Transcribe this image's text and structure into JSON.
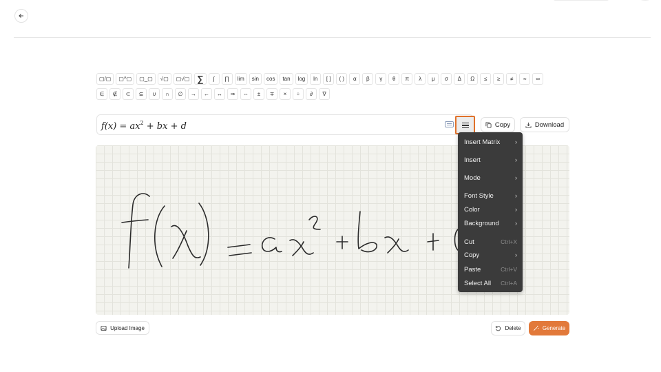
{
  "symbols_row1": [
    "▢/▢",
    "▢^▢",
    "▢_▢",
    "√▢",
    "▢√▢",
    "∑",
    "∫",
    "∏",
    "lim",
    "sin",
    "cos",
    "tan",
    "log",
    "ln",
    "[ ]",
    "( )",
    "α",
    "β",
    "γ",
    "θ",
    "π",
    "λ",
    "μ",
    "σ",
    "Δ",
    "Ω",
    "≤",
    "≥",
    "≠",
    "≈",
    "∞"
  ],
  "symbols_row2": [
    "∈",
    "∉",
    "⊂",
    "⊆",
    "∪",
    "∩",
    "∅",
    "→",
    "←",
    "↔",
    "⇒",
    "⇔",
    "±",
    "∓",
    "×",
    "÷",
    "∂",
    "∇"
  ],
  "expression": {
    "base": "f(x) = ax",
    "exponent": "2",
    "rest": " + bx + d"
  },
  "toolbar": {
    "copy_label": "Copy",
    "download_label": "Download"
  },
  "context_menu": {
    "items": [
      {
        "label": "Insert Matrix",
        "submenu": true
      },
      {
        "label": "Insert",
        "submenu": true
      },
      {
        "label": "Mode",
        "submenu": true
      },
      {
        "label": "Font Style",
        "submenu": true
      },
      {
        "label": "Color",
        "submenu": true
      },
      {
        "label": "Background",
        "submenu": true
      },
      {
        "label": "Cut",
        "shortcut": "Ctrl+X"
      },
      {
        "label": "Copy",
        "submenu": true
      },
      {
        "label": "Paste",
        "shortcut": "Ctrl+V"
      },
      {
        "label": "Select All",
        "shortcut": "Ctrl+A"
      }
    ]
  },
  "bottom": {
    "upload_label": "Upload Image",
    "delete_label": "Delete",
    "generate_label": "Generate"
  },
  "colors": {
    "accent": "#e2793a",
    "menu_bg": "#3b3b3b",
    "canvas_bg": "#f3f3ee"
  }
}
